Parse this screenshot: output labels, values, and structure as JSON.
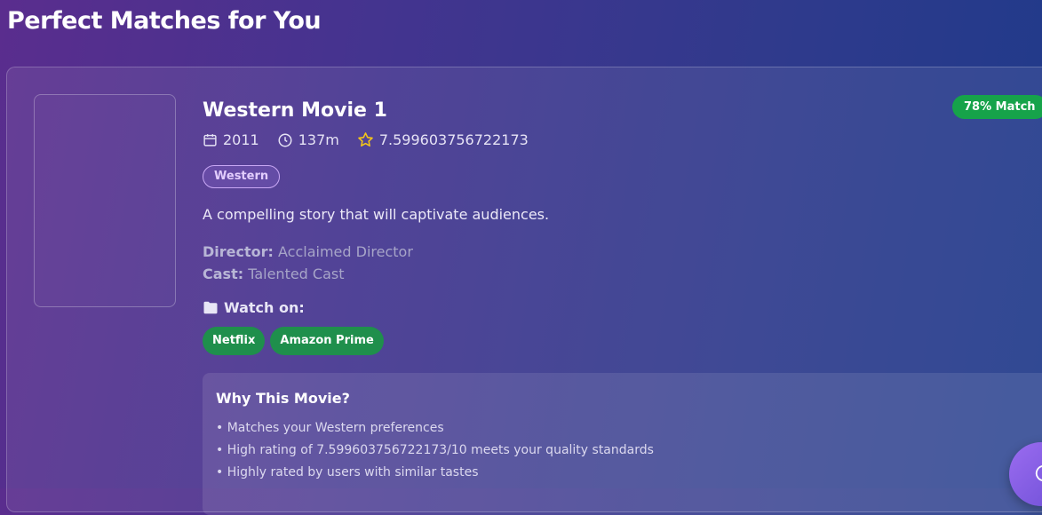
{
  "page": {
    "title": "Perfect Matches for You"
  },
  "movie": {
    "title": "Western Movie 1",
    "year": "2011",
    "runtime": "137m",
    "rating": "7.599603756722173",
    "genre": "Western",
    "description": "A compelling story that will captivate audiences.",
    "director_label": "Director:",
    "director": "Acclaimed Director",
    "cast_label": "Cast:",
    "cast": "Talented Cast",
    "match": "78% Match"
  },
  "watch": {
    "label": "Watch on:",
    "providers": [
      "Netflix",
      "Amazon Prime"
    ]
  },
  "why": {
    "title": "Why This Movie?",
    "reasons": [
      "• Matches your Western preferences",
      "• High rating of 7.599603756722173/10 meets your quality standards",
      "• Highly rated by users with similar tastes"
    ]
  },
  "icons": {
    "year": "calendar-icon",
    "runtime": "clock-icon",
    "rating": "star-icon",
    "watch": "folder-icon",
    "chat": "chat-icon"
  },
  "colors": {
    "match_badge": "#16a34a",
    "provider": "#1f8f4c",
    "genre_border": "#c9a8f5",
    "star": "#f5c518"
  }
}
